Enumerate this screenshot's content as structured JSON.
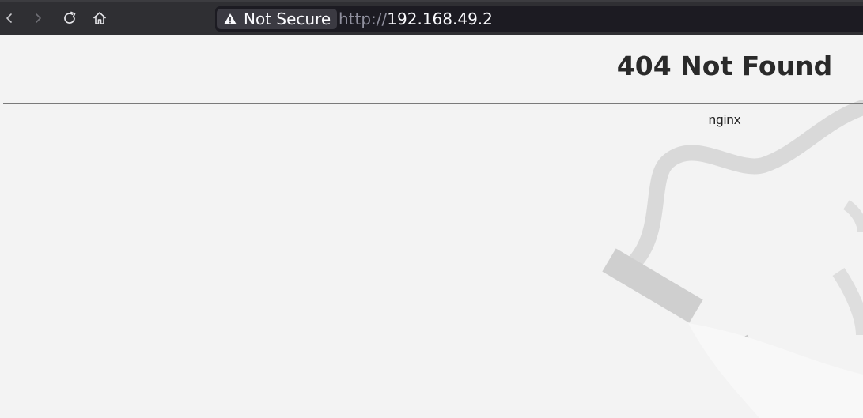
{
  "browser": {
    "back_icon": "chevron-left-icon",
    "forward_icon": "chevron-right-icon",
    "reload_icon": "reload-icon",
    "home_icon": "home-icon",
    "security": {
      "icon": "warning-triangle-icon",
      "label": "Not Secure"
    },
    "url": {
      "scheme": "http://",
      "host": "192.168.49.2"
    }
  },
  "page": {
    "title": "404 Not Found",
    "server": "nginx"
  },
  "colors": {
    "toolbar_bg": "#2f2f33",
    "urlbar_bg": "#1c1b22",
    "page_bg": "#f3f3f3",
    "text": "#2a2a2a"
  }
}
